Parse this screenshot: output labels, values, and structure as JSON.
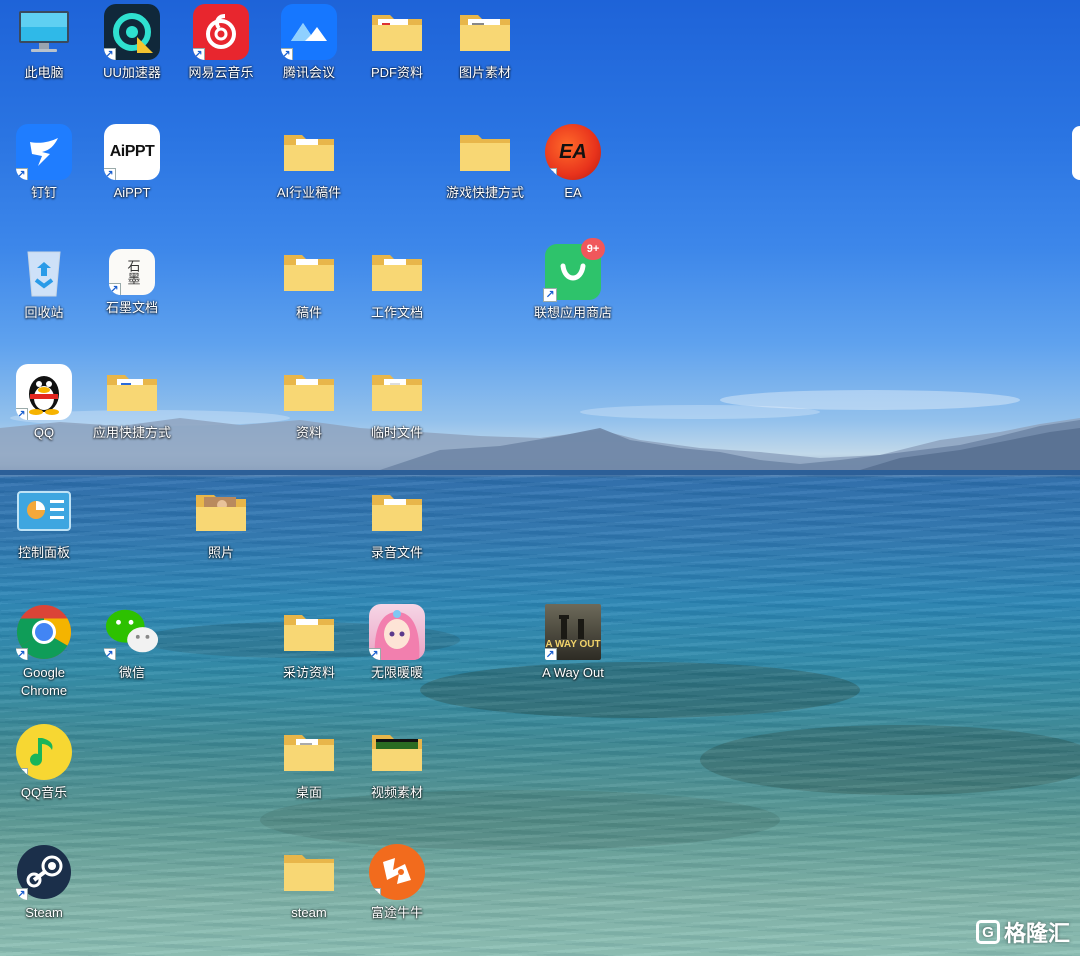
{
  "desktop_icons": {
    "this_pc": {
      "label": "此电脑",
      "icon": "monitor-icon"
    },
    "uu": {
      "label": "UU加速器",
      "icon": "uu-accelerator-icon"
    },
    "netease": {
      "label": "网易云音乐",
      "icon": "netease-music-icon"
    },
    "tencent_meeting": {
      "label": "腾讯会议",
      "icon": "tencent-meeting-icon"
    },
    "pdf": {
      "label": "PDF资料",
      "icon": "folder-icon"
    },
    "pictures": {
      "label": "图片素材",
      "icon": "folder-icon"
    },
    "dingtalk": {
      "label": "钉钉",
      "icon": "dingtalk-icon"
    },
    "aippt": {
      "label": "AiPPT",
      "icon": "aippt-icon",
      "logo_text": "AiPPT"
    },
    "ai_drafts": {
      "label": "AI行业稿件",
      "icon": "folder-icon"
    },
    "game_shortcuts": {
      "label": "游戏快捷方式",
      "icon": "folder-icon"
    },
    "ea": {
      "label": "EA",
      "icon": "ea-icon",
      "logo_text": "EA"
    },
    "recycle": {
      "label": "回收站",
      "icon": "recycle-bin-icon"
    },
    "shimo": {
      "label": "石墨文档",
      "icon": "shimo-docs-icon",
      "logo_text": "石墨"
    },
    "drafts": {
      "label": "稿件",
      "icon": "folder-icon"
    },
    "work_docs": {
      "label": "工作文档",
      "icon": "folder-icon"
    },
    "lenovo_store": {
      "label": "联想应用商店",
      "icon": "lenovo-store-icon",
      "badge": "9+"
    },
    "qq": {
      "label": "QQ",
      "icon": "qq-penguin-icon"
    },
    "app_shortcuts": {
      "label": "应用快捷方式",
      "icon": "folder-icon"
    },
    "materials": {
      "label": "资料",
      "icon": "folder-icon"
    },
    "temp_files": {
      "label": "临时文件",
      "icon": "folder-icon"
    },
    "control_panel": {
      "label": "控制面板",
      "icon": "control-panel-icon"
    },
    "photos": {
      "label": "照片",
      "icon": "folder-icon"
    },
    "recordings": {
      "label": "录音文件",
      "icon": "folder-icon"
    },
    "chrome": {
      "label": "Google Chrome",
      "icon": "chrome-icon"
    },
    "wechat": {
      "label": "微信",
      "icon": "wechat-icon"
    },
    "interviews": {
      "label": "采访资料",
      "icon": "folder-icon"
    },
    "infinity_nikki": {
      "label": "无限暖暖",
      "icon": "infinity-nikki-icon"
    },
    "a_way_out": {
      "label": "A Way Out",
      "icon": "a-way-out-icon",
      "logo_text": "A WAY OUT"
    },
    "qq_music": {
      "label": "QQ音乐",
      "icon": "qq-music-icon"
    },
    "desktop_folder": {
      "label": "桌面",
      "icon": "folder-icon"
    },
    "video_assets": {
      "label": "视频素材",
      "icon": "folder-icon"
    },
    "steam": {
      "label": "Steam",
      "icon": "steam-icon"
    },
    "steam_folder": {
      "label": "steam",
      "icon": "folder-icon"
    },
    "futu": {
      "label": "富途牛牛",
      "icon": "futu-niuniu-icon"
    }
  },
  "watermark": {
    "text": "格隆汇",
    "mark": "G"
  }
}
